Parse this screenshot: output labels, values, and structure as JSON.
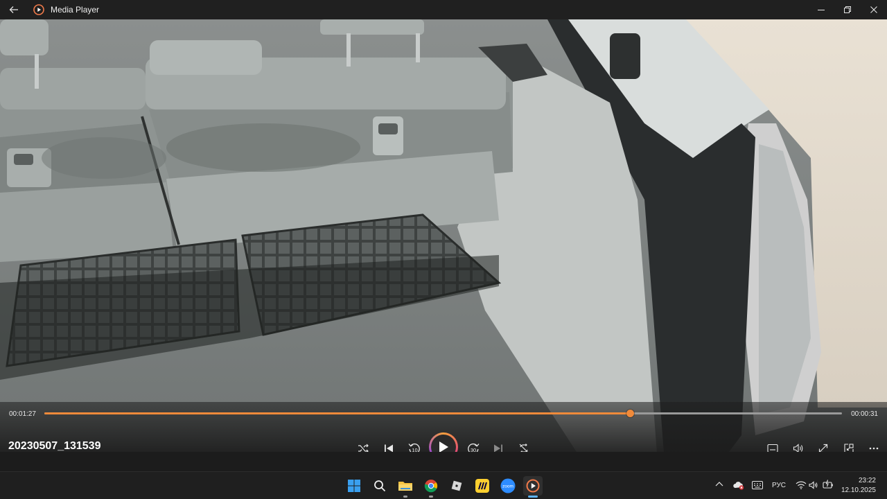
{
  "window": {
    "title": "Media Player"
  },
  "player": {
    "current_time": "00:01:27",
    "duration": "00:00:31",
    "progress": 0.734,
    "file_name": "20230507_131539",
    "accent_color": "#f08a3a"
  },
  "controls": {
    "shuffle": "shuffle-icon",
    "previous": "previous-icon",
    "rewind_seconds": "10",
    "play": "play-icon",
    "forward_seconds": "30",
    "next": "next-icon",
    "repeat": "repeat-off-icon",
    "right_icons": [
      "subtitles-icon",
      "volume-icon",
      "fullscreen-icon",
      "mini-player-icon",
      "more-icon"
    ]
  },
  "taskbar": {
    "apps": [
      "windows-start-icon",
      "search-icon",
      "file-explorer-icon",
      "chrome-icon",
      "roblox-icon",
      "miro-icon",
      "zoom-icon",
      "media-player-icon"
    ],
    "zoom_label": "zoom",
    "language": "РУС",
    "time": "23:22",
    "date": "12.10.2025"
  }
}
